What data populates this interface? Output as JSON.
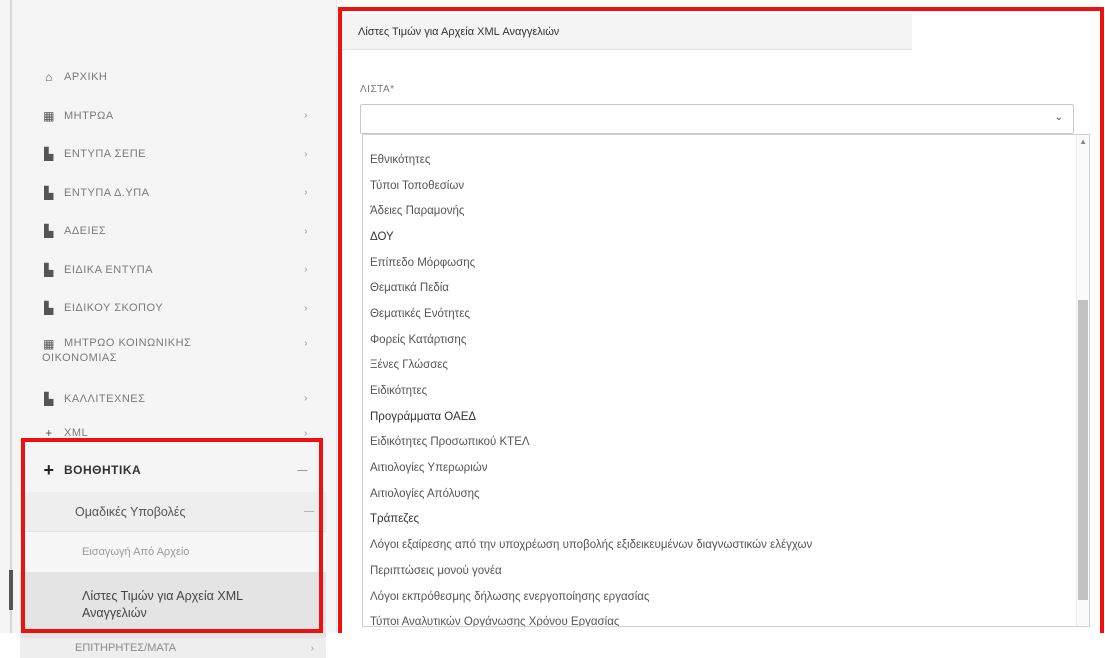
{
  "sidebar": {
    "items": [
      {
        "label": "ΑΡΧΙΚΗ",
        "icon": "home-icon",
        "glyph": "⌂",
        "has_children": false
      },
      {
        "label": "ΜΗΤΡΩΑ",
        "icon": "grid-icon",
        "glyph": "▦",
        "has_children": true
      },
      {
        "label": "ΕΝΤΥΠΑ ΣΕΠΕ",
        "icon": "folder-icon",
        "glyph": "▙",
        "has_children": true
      },
      {
        "label": "ΕΝΤΥΠΑ Δ.ΥΠΑ",
        "icon": "folder-icon",
        "glyph": "▙",
        "has_children": true
      },
      {
        "label": "ΑΔΕΙΕΣ",
        "icon": "folder-icon",
        "glyph": "▙",
        "has_children": true
      },
      {
        "label": "ΕΙΔΙΚΑ ΕΝΤΥΠΑ",
        "icon": "folder-icon",
        "glyph": "▙",
        "has_children": true
      },
      {
        "label": "ΕΙΔΙΚΟΥ ΣΚΟΠΟΥ",
        "icon": "folder-icon",
        "glyph": "▙",
        "has_children": true
      },
      {
        "label": "ΜΗΤΡΩΟ ΚΟΙΝΩΝΙΚΗΣ ΟΙΚΟΝΟΜΙΑΣ",
        "icon": "grid-icon",
        "glyph": "▦",
        "has_children": true
      },
      {
        "label": "ΚΑΛΛΙΤΕΧΝΕΣ",
        "icon": "folder-icon",
        "glyph": "▙",
        "has_children": true
      },
      {
        "label": "XML",
        "icon": "plus-icon",
        "glyph": "+",
        "has_children": true
      }
    ],
    "active_section": {
      "label": "ΒΟΗΘΗΤΙΚΑ",
      "glyph": "+",
      "chevron": "—"
    },
    "sub_section": {
      "label": "Ομαδικές Υποβολές",
      "chevron": "—"
    },
    "leaf_items": [
      {
        "label": "Εισαγωγή Από Αρχείο"
      },
      {
        "label": "Λίστες Τιμών για Αρχεία XML Αναγγελιών"
      }
    ],
    "next_sub_section": {
      "label": "ΕΠΙΤΗΡΗΤΕΣ/ΜΑΤΑ",
      "chevron": "›"
    }
  },
  "main": {
    "panel_title": "Λίστες Τιμών για Αρχεία XML Αναγγελιών",
    "list_field": {
      "label": "ΛΙΣΤΑ*",
      "value": "",
      "arrow_glyph": "⌄",
      "options": [
        "Εθνικότητες",
        "Τύποι Τοποθεσίων",
        "Άδειες Παραμονής",
        "ΔΟΥ",
        "Επίπεδο Μόρφωσης",
        "Θεματικά Πεδία",
        "Θεματικές Ενότητες",
        "Φορείς Κατάρτισης",
        "Ξένες Γλώσσες",
        "Ειδικότητες",
        "Προγράμματα ΟΑΕΔ",
        "Ειδικότητες Προσωπικού ΚΤΕΛ",
        "Αιτιολογίες Υπερωριών",
        "Αιτιολογίες Απόλυσης",
        "Τράπεζες",
        "Λόγοι εξαίρεσης από την υποχρέωση υποβολής εξιδεικευμένων διαγνωστικών ελέγχων",
        "Περιπτώσεις μονού γονέα",
        "Λόγοι εκπρόθεσμης δήλωσης ενεργοποίησης εργασίας",
        "Τύποι Αναλυτικών Οργάνωσης Χρόνου Εργασίας"
      ],
      "dark_options": [
        3,
        10,
        14
      ]
    }
  },
  "annotation": {
    "highlight_color": "#ee1111"
  }
}
